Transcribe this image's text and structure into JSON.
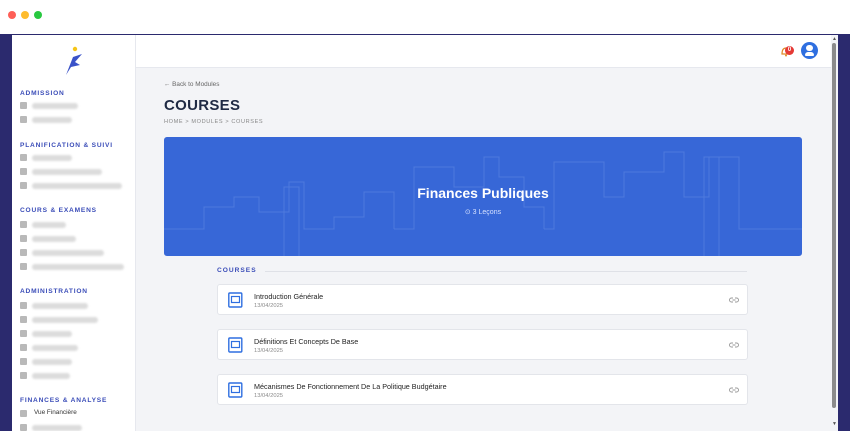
{
  "sidebar": {
    "sections": [
      {
        "title": "ADMISSION"
      },
      {
        "title": "PLANIFICATION & SUIVI"
      },
      {
        "title": "COURS & EXAMENS"
      },
      {
        "title": "ADMINISTRATION"
      },
      {
        "title": "FINANCES & ANALYSE"
      }
    ],
    "finance_item_label": "Vue Financière"
  },
  "topbar": {
    "notification_count": "0"
  },
  "header": {
    "back_link": "← Back to Modules",
    "title": "COURSES",
    "breadcrumb": "HOME > MODULES > COURSES"
  },
  "hero": {
    "title": "Finances Publiques",
    "lessons": "⊙ 3 Leçons"
  },
  "courses": {
    "section_label": "COURSES",
    "items": [
      {
        "title": "Introduction Générale",
        "date": "13/04/2025"
      },
      {
        "title": "Définitions Et Concepts De Base",
        "date": "13/04/2025"
      },
      {
        "title": "Mécanismes De Fonctionnement De La Politique Budgétaire",
        "date": "13/04/2025"
      }
    ]
  },
  "colors": {
    "accent": "#3b4db8",
    "hero_blue": "#3a6ad8",
    "frame": "#2b2a6e"
  }
}
